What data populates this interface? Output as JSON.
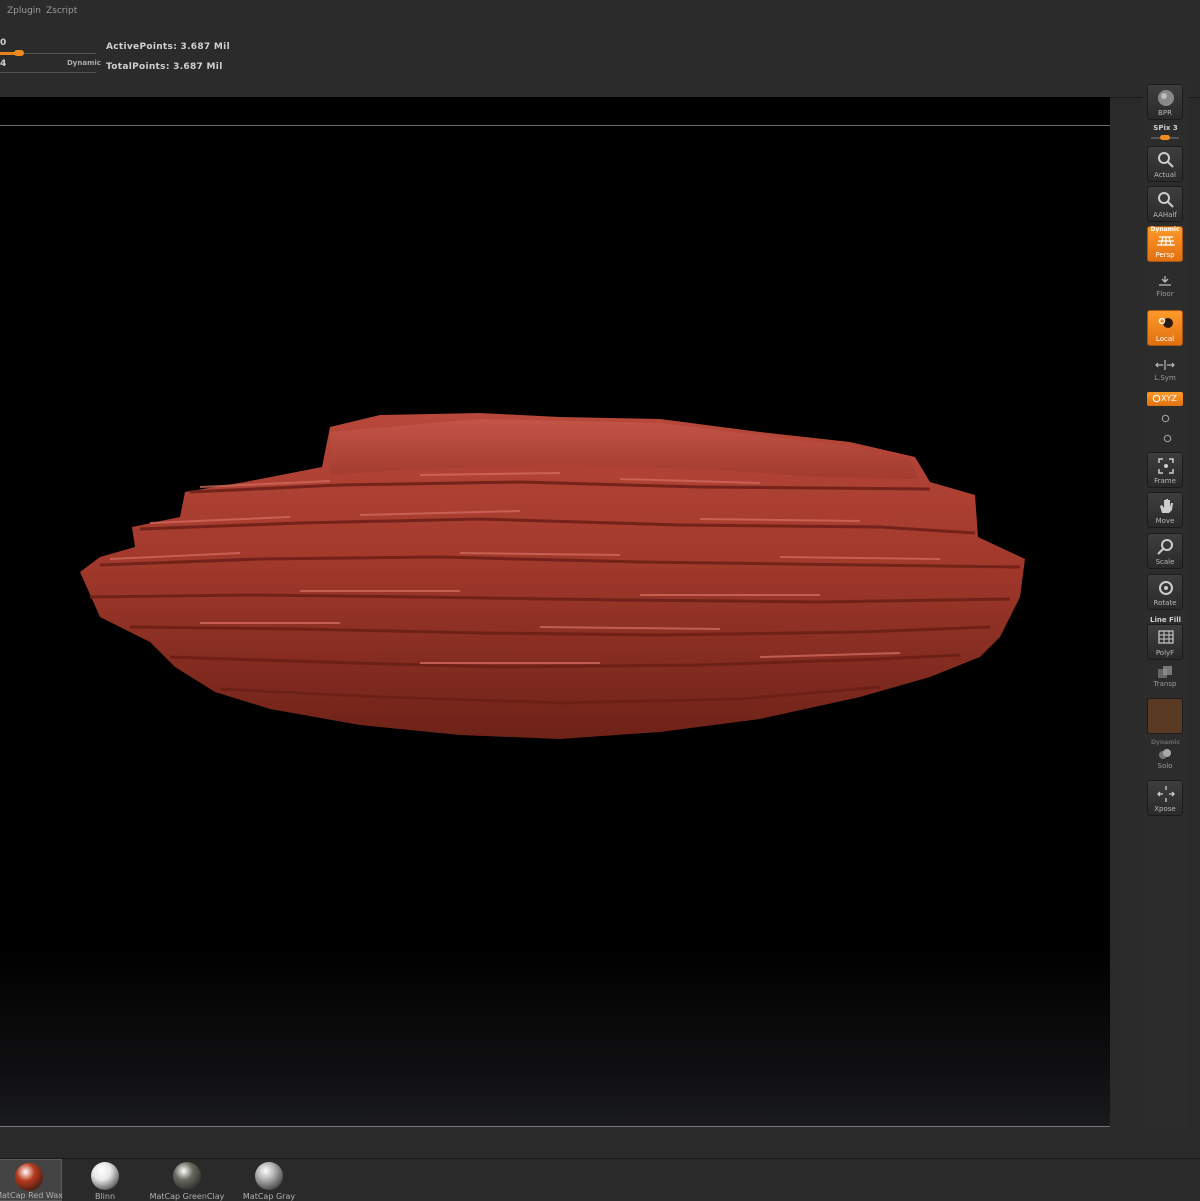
{
  "menu": {
    "items": [
      "Zplugin",
      "Zscript"
    ]
  },
  "info": {
    "top_value": "0",
    "bottom_value": "4",
    "dynamic_label": "Dynamic",
    "active_points": "ActivePoints: 3.687 Mil",
    "total_points": "TotalPoints: 3.687 Mil"
  },
  "shelf": {
    "bpr": {
      "label": "BPR",
      "icon": "bpr-sphere-icon"
    },
    "spix_label": "SPix 3",
    "actual": {
      "label": "Actual",
      "icon": "magnifier-icon"
    },
    "aahalf": {
      "label": "AAHalf",
      "icon": "magnifier-icon"
    },
    "persp": {
      "label": "Persp",
      "sup": "Dynamic",
      "icon": "perspective-grid-icon"
    },
    "floor": {
      "label": "Floor",
      "icon": "floor-icon"
    },
    "local": {
      "label": "Local",
      "icon": "local-pivot-icon"
    },
    "lsym": {
      "label": "L.Sym",
      "icon": "symmetry-arrows-icon"
    },
    "xyz": {
      "label": "XYZ",
      "icon": "rotate-axis-icon"
    },
    "frame": {
      "label": "Frame",
      "icon": "frame-icon"
    },
    "move": {
      "label": "Move",
      "icon": "hand-icon"
    },
    "scale": {
      "label": "Scale",
      "icon": "magnifier-icon"
    },
    "rotate": {
      "label": "Rotate",
      "icon": "rotate-icon"
    },
    "linefill_label": "Line Fill",
    "polyf": {
      "label": "PolyF",
      "icon": "polygrid-icon"
    },
    "transp": {
      "label": "Transp",
      "icon": "transparency-icon"
    },
    "solo_sup": "Dynamic",
    "solo": {
      "label": "Solo",
      "icon": "solo-icon"
    },
    "xpose": {
      "label": "Xpose",
      "icon": "xpose-icon"
    }
  },
  "materials": [
    {
      "label": "MatCap Red Wax",
      "color": "#b83a1c"
    },
    {
      "label": "Blinn",
      "color": "#e8e8e8"
    },
    {
      "label": "MatCap GreenClay",
      "color": "#6a6b60"
    },
    {
      "label": "MatCap Gray",
      "color": "#b0b0b0"
    }
  ],
  "colors": {
    "accent": "#f08a1e",
    "model": "#a2392c",
    "canvas": "#000000"
  }
}
